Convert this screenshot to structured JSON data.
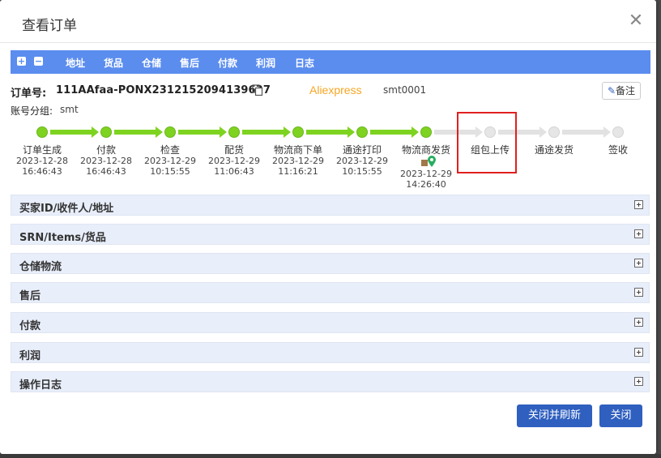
{
  "dialog": {
    "title": "查看订单",
    "close_glyph": "✕"
  },
  "toolbar": {
    "expand_glyph": "+",
    "collapse_glyph": "−",
    "links": [
      "地址",
      "货品",
      "仓储",
      "售后",
      "付款",
      "利润",
      "日志"
    ]
  },
  "order": {
    "label": "订单号:",
    "number": "111AAfaa-PONX2312152094139637",
    "platform": "Aliexpress",
    "store": "smt0001",
    "remark_label": "备注",
    "group_label": "账号分组:",
    "group_value": "smt"
  },
  "steps": [
    {
      "label": "订单生成",
      "date": "2023-12-28",
      "time": "16:46:43",
      "done": true
    },
    {
      "label": "付款",
      "date": "2023-12-28",
      "time": "16:46:43",
      "done": true
    },
    {
      "label": "检查",
      "date": "2023-12-29",
      "time": "10:15:55",
      "done": true
    },
    {
      "label": "配货",
      "date": "2023-12-29",
      "time": "11:06:43",
      "done": true
    },
    {
      "label": "物流商下单",
      "date": "2023-12-29",
      "time": "11:16:21",
      "done": true
    },
    {
      "label": "通途打印",
      "date": "2023-12-29",
      "time": "10:15:55",
      "done": true
    },
    {
      "label": "物流商发货",
      "date": "2023-12-29",
      "time": "14:26:40",
      "done": true
    },
    {
      "label": "组包上传",
      "date": "",
      "time": "",
      "done": false
    },
    {
      "label": "通途发货",
      "date": "",
      "time": "",
      "done": false
    },
    {
      "label": "签收",
      "date": "",
      "time": "",
      "done": false
    }
  ],
  "sections": [
    "买家ID/收件人/地址",
    "SRN/Items/货品",
    "仓储物流",
    "售后",
    "付款",
    "利润",
    "操作日志"
  ],
  "buttons": {
    "close_refresh": "关闭并刷新",
    "close": "关闭"
  },
  "colors": {
    "toolbar": "#5b8def",
    "done": "#7ed321",
    "todo": "#e2e2e2",
    "primary_button": "#2f5fbf",
    "highlight": "#e02020",
    "platform": "#f5a623"
  }
}
